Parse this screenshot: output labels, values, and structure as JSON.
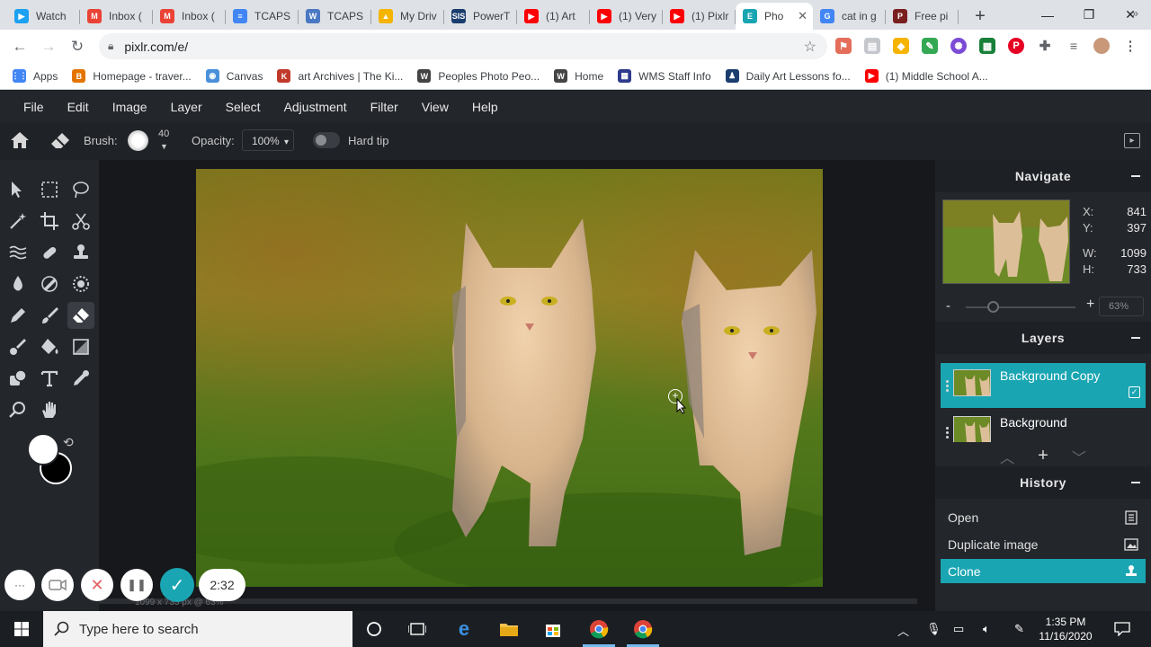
{
  "browser": {
    "tabs": [
      {
        "title": "Watch",
        "color": "#1da1f2",
        "letter": "▶"
      },
      {
        "title": "Inbox (",
        "color": "#ea4335",
        "letter": "M"
      },
      {
        "title": "Inbox (",
        "color": "#ea4335",
        "letter": "M"
      },
      {
        "title": "TCAPS",
        "color": "#4285f4",
        "letter": "≡"
      },
      {
        "title": "TCAPS",
        "color": "#4a78c2",
        "letter": "W"
      },
      {
        "title": "My Driv",
        "color": "#f4b400",
        "letter": "▲"
      },
      {
        "title": "PowerT",
        "color": "#1a3d6e",
        "letter": "SIS"
      },
      {
        "title": "(1) Art",
        "color": "#ff0000",
        "letter": "▶"
      },
      {
        "title": "(1) Very",
        "color": "#ff0000",
        "letter": "▶"
      },
      {
        "title": "(1) Pixlr",
        "color": "#ff0000",
        "letter": "▶"
      },
      {
        "title": "Pho",
        "color": "#1aa5b2",
        "letter": "E",
        "active": true
      },
      {
        "title": "cat in g",
        "color": "#4285f4",
        "letter": "G"
      },
      {
        "title": "Free pi",
        "color": "#7a1f1f",
        "letter": "P"
      }
    ],
    "new_tab_symbol": "+",
    "window_controls": {
      "minimize": "—",
      "restore": "❐",
      "close": "✕"
    },
    "url": "pixlr.com/e/",
    "bookmarks": [
      {
        "label": "Apps",
        "color": "#4285f4",
        "letter": "⋮⋮"
      },
      {
        "label": "Homepage - traver...",
        "color": "#e37400",
        "letter": "B"
      },
      {
        "label": "Canvas",
        "color": "#4a90d9",
        "letter": "◉"
      },
      {
        "label": "art Archives | The Ki...",
        "color": "#c0392b",
        "letter": "K"
      },
      {
        "label": "Peoples Photo Peo...",
        "color": "#444444",
        "letter": "W"
      },
      {
        "label": "Home",
        "color": "#444444",
        "letter": "W"
      },
      {
        "label": "WMS Staff Info",
        "color": "#2e3a8c",
        "letter": "▦"
      },
      {
        "label": "Daily Art Lessons fo...",
        "color": "#1a3d6e",
        "letter": "♟"
      },
      {
        "label": "(1) Middle School A...",
        "color": "#ff0000",
        "letter": "▶"
      }
    ],
    "bookmarks_more": "»"
  },
  "app": {
    "menu": [
      "File",
      "Edit",
      "Image",
      "Layer",
      "Select",
      "Adjustment",
      "Filter",
      "View",
      "Help"
    ],
    "options": {
      "brush_label": "Brush:",
      "brush_size": "40",
      "opacity_label": "Opacity:",
      "opacity_value": "100%",
      "opacity_caret": "▾",
      "hard_tip_label": "Hard tip",
      "hard_tip_on": false
    },
    "tools": [
      "arrange-tool",
      "marquee-tool",
      "lasso-tool",
      "magic-wand-tool",
      "crop-tool",
      "cutout-tool",
      "liquify-tool",
      "heal-tool",
      "clone-stamp-tool",
      "drop-tool",
      "dodge-burn-tool",
      "sponge-tool",
      "pencil-tool",
      "brush-tool",
      "eraser-tool",
      "color-replace-tool",
      "fill-tool",
      "gradient-tool",
      "shape-tool",
      "text-tool",
      "eyedropper-tool",
      "zoom-tool",
      "hand-tool"
    ],
    "selected_tool": "eraser-tool",
    "colors": {
      "foreground": "#ffffff",
      "background": "#000000",
      "accent": "#1aa5b2"
    },
    "canvas_info": "1099 x 733 px @ 63%",
    "navigate": {
      "title": "Navigate",
      "x_label": "X:",
      "x": "841",
      "y_label": "Y:",
      "y": "397",
      "w_label": "W:",
      "w": "1099",
      "h_label": "H:",
      "h": "733",
      "zoom_minus": "-",
      "zoom_plus": "+",
      "zoom": "63%"
    },
    "layers": {
      "title": "Layers",
      "items": [
        {
          "name": "Background Copy",
          "active": true
        },
        {
          "name": "Background",
          "active": false
        }
      ],
      "add_symbol": "+"
    },
    "history": {
      "title": "History",
      "items": [
        {
          "label": "Open",
          "icon": "document-icon"
        },
        {
          "label": "Duplicate image",
          "icon": "image-icon"
        },
        {
          "label": "Clone",
          "icon": "clone-stamp-icon",
          "active": true
        }
      ]
    }
  },
  "recorder": {
    "timer": "2:32",
    "more_symbol": "···",
    "cancel_symbol": "✕",
    "pause_symbol": "❚❚",
    "done_symbol": "✓"
  },
  "taskbar": {
    "search_placeholder": "Type here to search",
    "time": "1:35 PM",
    "date": "11/16/2020"
  }
}
